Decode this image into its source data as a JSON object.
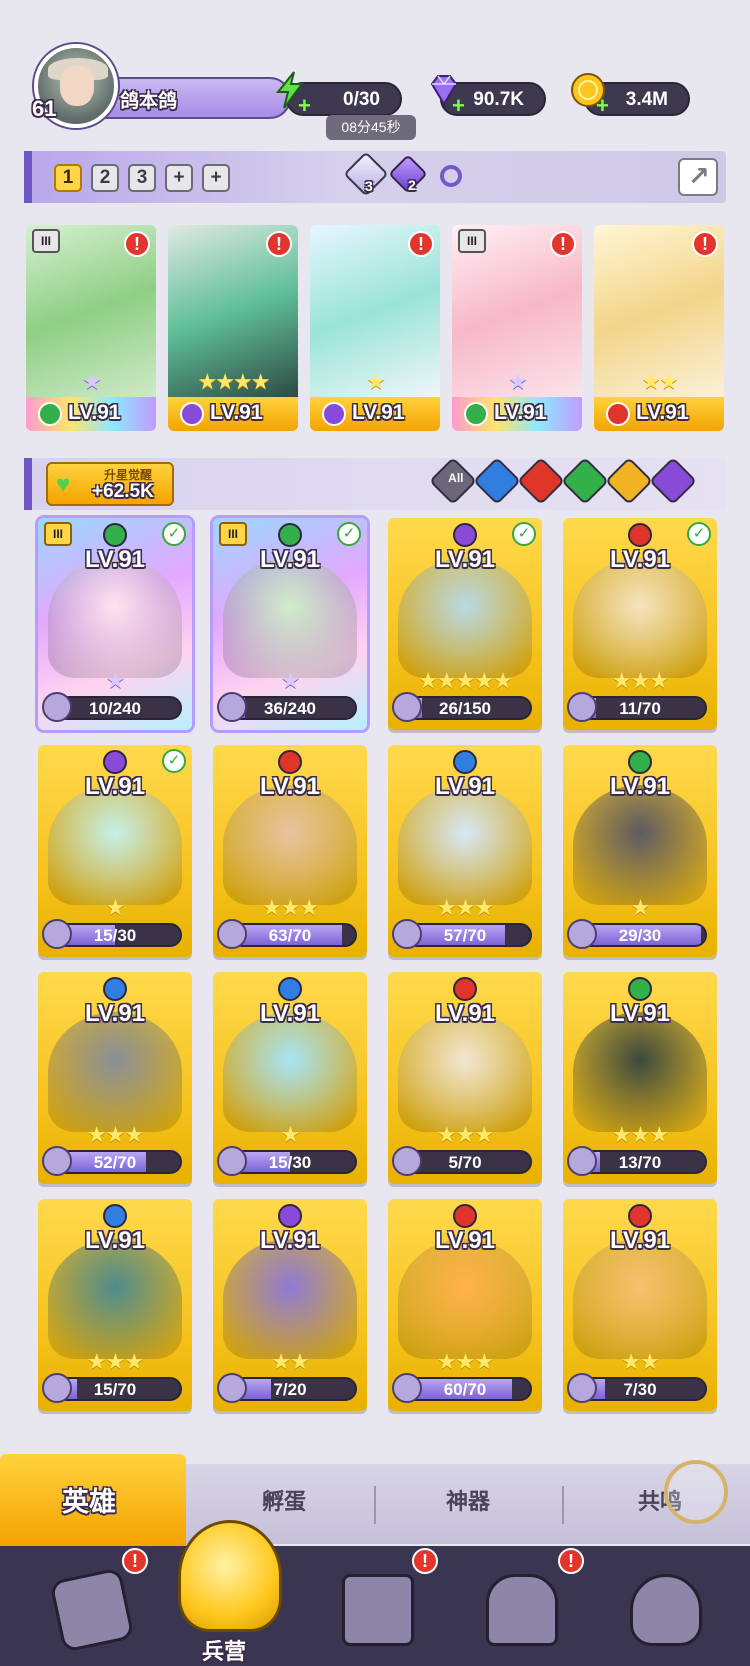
{
  "profile": {
    "level": "61",
    "name": "鸽本鸽"
  },
  "resources": {
    "stamina": {
      "value": "0/30",
      "timer": "08分45秒",
      "icon": "lightning-icon"
    },
    "gems": {
      "value": "90.7K",
      "icon": "diamond-icon"
    },
    "coins": {
      "value": "3.4M",
      "icon": "coin-icon"
    }
  },
  "team_bar": {
    "slots": [
      "1",
      "2",
      "3",
      "+",
      "+"
    ],
    "active_slot": "1",
    "gem_light": "3",
    "gem_dark": "2"
  },
  "team": [
    {
      "level": "LV.91",
      "element": "wind",
      "stars": "★",
      "star_style": "purple",
      "tier": "III",
      "alert": true
    },
    {
      "level": "LV.91",
      "element": "dark",
      "stars": "★★★★",
      "star_style": "gold",
      "tier": "",
      "alert": true
    },
    {
      "level": "LV.91",
      "element": "dark",
      "stars": "★",
      "star_style": "gold",
      "tier": "",
      "alert": true
    },
    {
      "level": "LV.91",
      "element": "wind",
      "stars": "★",
      "star_style": "purple",
      "tier": "III",
      "alert": true
    },
    {
      "level": "LV.91",
      "element": "fire",
      "stars": "★★",
      "star_style": "gold",
      "tier": "",
      "alert": true
    }
  ],
  "awaken": {
    "title": "升星觉醒",
    "value": "+62.5K"
  },
  "filters": [
    {
      "key": "all",
      "label": "All"
    },
    {
      "key": "water",
      "label": ""
    },
    {
      "key": "fire",
      "label": ""
    },
    {
      "key": "wind",
      "label": ""
    },
    {
      "key": "light",
      "label": ""
    },
    {
      "key": "dark",
      "label": ""
    }
  ],
  "heroes": [
    {
      "level": "LV.91",
      "element": "wind",
      "progress": "10/240",
      "fraction": 0.04,
      "stars": "★",
      "star_style": "purple",
      "checked": true,
      "tier": "III",
      "rainbow": true
    },
    {
      "level": "LV.91",
      "element": "wind",
      "progress": "36/240",
      "fraction": 0.15,
      "stars": "★",
      "star_style": "purple",
      "checked": true,
      "tier": "III",
      "rainbow": true
    },
    {
      "level": "LV.91",
      "element": "dark",
      "progress": "26/150",
      "fraction": 0.17,
      "stars": "★★★★★",
      "star_style": "gold",
      "checked": true,
      "tier": "",
      "rainbow": false
    },
    {
      "level": "LV.91",
      "element": "fire",
      "progress": "11/70",
      "fraction": 0.16,
      "stars": "★★★",
      "star_style": "gold",
      "checked": true,
      "tier": "",
      "rainbow": false
    },
    {
      "level": "LV.91",
      "element": "dark",
      "progress": "15/30",
      "fraction": 0.5,
      "stars": "★",
      "star_style": "gold",
      "checked": true,
      "tier": "",
      "rainbow": false
    },
    {
      "level": "LV.91",
      "element": "fire",
      "progress": "63/70",
      "fraction": 0.9,
      "stars": "★★★",
      "star_style": "gold",
      "checked": false,
      "tier": "",
      "rainbow": false
    },
    {
      "level": "LV.91",
      "element": "water",
      "progress": "57/70",
      "fraction": 0.81,
      "stars": "★★★",
      "star_style": "gold",
      "checked": false,
      "tier": "",
      "rainbow": false
    },
    {
      "level": "LV.91",
      "element": "wind",
      "progress": "29/30",
      "fraction": 0.97,
      "stars": "★",
      "star_style": "gold",
      "checked": false,
      "tier": "",
      "rainbow": false
    },
    {
      "level": "LV.91",
      "element": "water",
      "progress": "52/70",
      "fraction": 0.74,
      "stars": "★★★",
      "star_style": "gold",
      "checked": false,
      "tier": "",
      "rainbow": false
    },
    {
      "level": "LV.91",
      "element": "water",
      "progress": "15/30",
      "fraction": 0.5,
      "stars": "★",
      "star_style": "gold",
      "checked": false,
      "tier": "",
      "rainbow": false
    },
    {
      "level": "LV.91",
      "element": "fire",
      "progress": "5/70",
      "fraction": 0.07,
      "stars": "★★★",
      "star_style": "gold",
      "checked": false,
      "tier": "",
      "rainbow": false
    },
    {
      "level": "LV.91",
      "element": "wind",
      "progress": "13/70",
      "fraction": 0.19,
      "stars": "★★★",
      "star_style": "gold",
      "checked": false,
      "tier": "",
      "rainbow": false
    },
    {
      "level": "LV.91",
      "element": "water",
      "progress": "15/70",
      "fraction": 0.21,
      "stars": "★★★",
      "star_style": "gold",
      "checked": false,
      "tier": "",
      "rainbow": false
    },
    {
      "level": "LV.91",
      "element": "dark",
      "progress": "7/20",
      "fraction": 0.35,
      "stars": "★★",
      "star_style": "gold",
      "checked": false,
      "tier": "",
      "rainbow": false
    },
    {
      "level": "LV.91",
      "element": "fire",
      "progress": "60/70",
      "fraction": 0.86,
      "stars": "★★★",
      "star_style": "gold",
      "checked": false,
      "tier": "",
      "rainbow": false
    },
    {
      "level": "LV.91",
      "element": "fire",
      "progress": "7/30",
      "fraction": 0.23,
      "stars": "★★",
      "star_style": "gold",
      "checked": false,
      "tier": "",
      "rainbow": false
    }
  ],
  "tabs": {
    "heroes": "英雄",
    "hatch": "孵蛋",
    "artifacts": "神器",
    "resonance": "共鸣"
  },
  "nav": {
    "barracks": "兵营"
  },
  "colors": {
    "wind": "#33b04a",
    "dark": "#8a4ad8",
    "fire": "#e0352b",
    "water": "#2f7ee0",
    "light": "#f0b323",
    "all": "#6b6778"
  }
}
